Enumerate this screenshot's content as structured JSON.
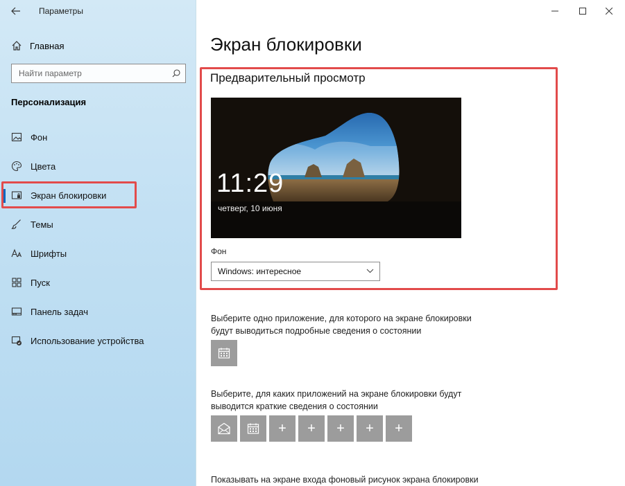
{
  "app": {
    "title": "Параметры"
  },
  "sidebar": {
    "home_label": "Главная",
    "search_placeholder": "Найти параметр",
    "section": "Персонализация",
    "items": [
      {
        "label": "Фон",
        "icon": "image-icon"
      },
      {
        "label": "Цвета",
        "icon": "palette-icon"
      },
      {
        "label": "Экран блокировки",
        "icon": "lock-screen-icon",
        "active": true
      },
      {
        "label": "Темы",
        "icon": "brush-icon"
      },
      {
        "label": "Шрифты",
        "icon": "font-icon"
      },
      {
        "label": "Пуск",
        "icon": "start-icon"
      },
      {
        "label": "Панель задач",
        "icon": "taskbar-icon"
      },
      {
        "label": "Использование устройства",
        "icon": "device-usage-icon"
      }
    ]
  },
  "main": {
    "title": "Экран блокировки",
    "preview": {
      "title": "Предварительный просмотр",
      "time": "11:29",
      "date": "четверг, 10 июня"
    },
    "background": {
      "label": "Фон",
      "selected": "Windows: интересное"
    },
    "detailed_status": {
      "text_line1": "Выберите одно приложение, для которого на экране блокировки",
      "text_line2": "будут выводиться подробные сведения о состоянии"
    },
    "quick_status": {
      "text_line1": "Выберите, для каких приложений на экране блокировки будут",
      "text_line2": "выводится краткие сведения о состоянии",
      "tiles": [
        "mail-icon",
        "calendar-icon",
        "+",
        "+",
        "+",
        "+",
        "+"
      ]
    },
    "signin_bg_text": "Показывать на экране входа фоновый рисунок экрана блокировки"
  },
  "colors": {
    "accent": "#0067c0",
    "highlight": "#e24b4b",
    "tile": "#9c9c9c"
  }
}
